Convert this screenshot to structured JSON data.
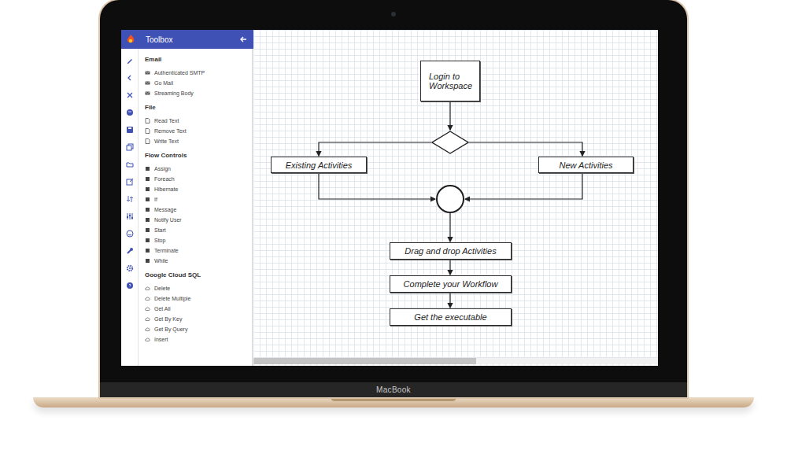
{
  "device": {
    "label": "MacBook"
  },
  "toolbox": {
    "title": "Toolbox",
    "sections": [
      {
        "title": "Email",
        "items": [
          "Authenticated SMTP",
          "Go Mail",
          "Streaming Body"
        ]
      },
      {
        "title": "File",
        "items": [
          "Read Text",
          "Remove Text",
          "Write Text"
        ]
      },
      {
        "title": "Flow Controls",
        "items": [
          "Assign",
          "Foreach",
          "Hibernate",
          "If",
          "Message",
          "Notify User",
          "Start",
          "Stop",
          "Terminate",
          "While"
        ]
      },
      {
        "title": "Google Cloud SQL",
        "items": [
          "Delete",
          "Delete Multiple",
          "Get All",
          "Get By Key",
          "Get By Query",
          "Insert"
        ]
      }
    ]
  },
  "diagram": {
    "nodes": [
      {
        "kind": "box",
        "label": "Login to Workspace"
      },
      {
        "kind": "decision"
      },
      {
        "kind": "box",
        "label": "Existing Activities"
      },
      {
        "kind": "box",
        "label": "New Activities"
      },
      {
        "kind": "junction"
      },
      {
        "kind": "box",
        "label": "Drag and drop Activities"
      },
      {
        "kind": "box",
        "label": "Complete your Workflow"
      },
      {
        "kind": "box",
        "label": "Get the executable"
      }
    ]
  }
}
